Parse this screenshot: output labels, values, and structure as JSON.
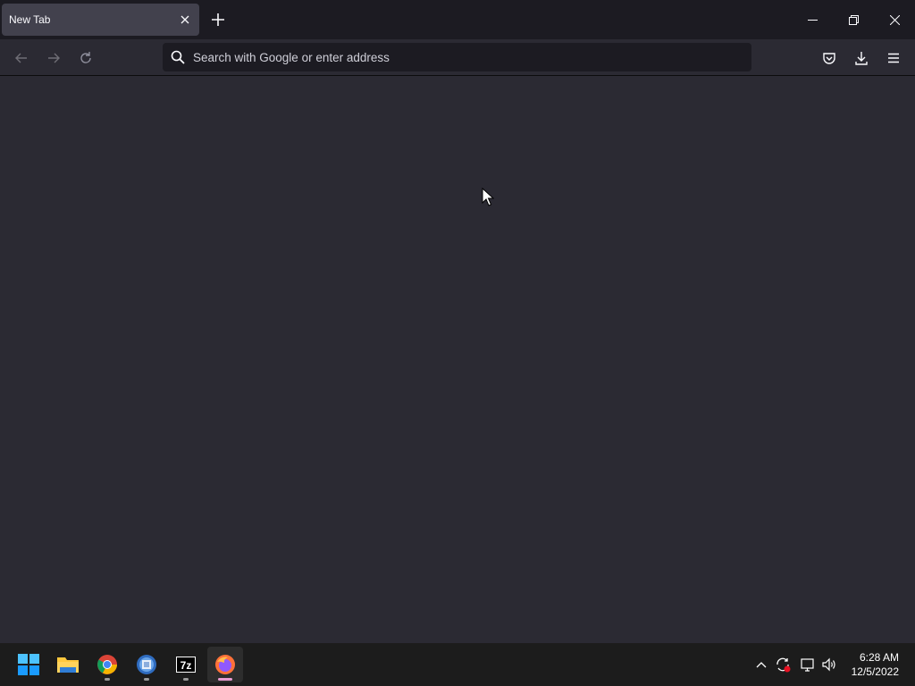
{
  "tab": {
    "title": "New Tab"
  },
  "urlbar": {
    "placeholder": "Search with Google or enter address"
  },
  "taskbar": {
    "apps": [
      "Start",
      "File Explorer",
      "Google Chrome",
      "App",
      "7-Zip",
      "Firefox"
    ],
    "time": "6:28 AM",
    "date": "12/5/2022"
  },
  "colors": {
    "titlebar": "#1c1b22",
    "tab_active": "#42414d",
    "page_bg": "#2b2a33",
    "urlbar_bg": "#1c1b22",
    "taskbar": "#1c1c1c",
    "firefox_indicator": "#e79bd1"
  }
}
